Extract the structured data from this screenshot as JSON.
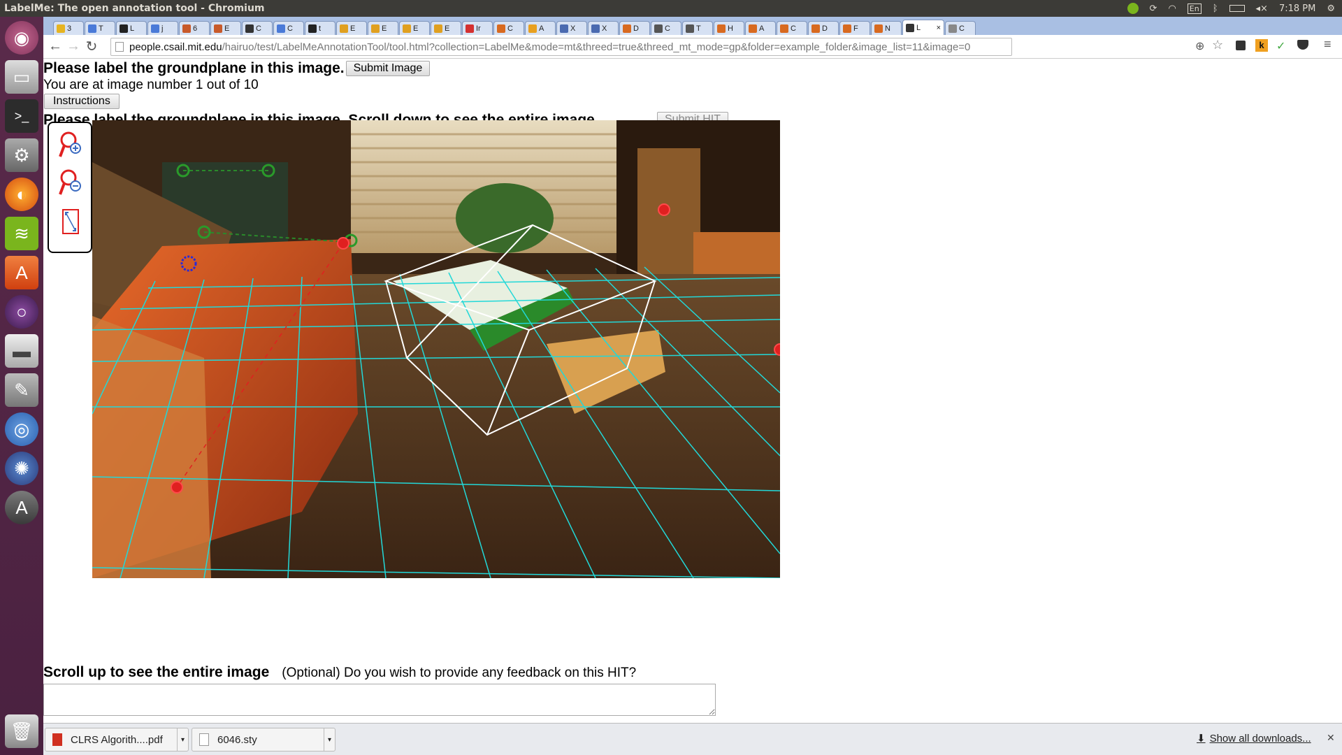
{
  "window_title": "LabelMe: The open annotation tool - Chromium",
  "system_tray": {
    "keyboard": "En",
    "time": "7:18 PM"
  },
  "tabs": [
    {
      "label": "3",
      "color": "#e6b422"
    },
    {
      "label": "T",
      "color": "#4a7ad8"
    },
    {
      "label": "L",
      "color": "#222222"
    },
    {
      "label": "j",
      "color": "#4a7ad8"
    },
    {
      "label": "6",
      "color": "#c85a2a"
    },
    {
      "label": "E",
      "color": "#c85a2a"
    },
    {
      "label": "C",
      "color": "#333333"
    },
    {
      "label": "C",
      "color": "#4a7ad8"
    },
    {
      "label": "t",
      "color": "#222222"
    },
    {
      "label": "E",
      "color": "#e0a020"
    },
    {
      "label": "E",
      "color": "#e0a020"
    },
    {
      "label": "E",
      "color": "#e0a020"
    },
    {
      "label": "E",
      "color": "#e0a020"
    },
    {
      "label": "Ir",
      "color": "#d43030"
    },
    {
      "label": "C",
      "color": "#d86a20"
    },
    {
      "label": "A",
      "color": "#e8a020"
    },
    {
      "label": "X",
      "color": "#4a6ab0"
    },
    {
      "label": "X",
      "color": "#4a6ab0"
    },
    {
      "label": "D",
      "color": "#d86a20"
    },
    {
      "label": "C",
      "color": "#555555"
    },
    {
      "label": "T",
      "color": "#555555"
    },
    {
      "label": "H",
      "color": "#d86a20"
    },
    {
      "label": "A",
      "color": "#d86a20"
    },
    {
      "label": "C",
      "color": "#d86a20"
    },
    {
      "label": "D",
      "color": "#d86a20"
    },
    {
      "label": "F",
      "color": "#d86a20"
    },
    {
      "label": "N",
      "color": "#d86a20"
    },
    {
      "label": "L",
      "color": "#333333",
      "active": true
    },
    {
      "label": "C",
      "color": "#888888"
    }
  ],
  "address_bar": {
    "host": "people.csail.mit.edu",
    "path": "/hairuo/test/LabelMeAnnotationTool/tool.html?collection=LabelMe&mode=mt&threed=true&threed_mt_mode=gp&folder=example_folder&image_list=11&image=0"
  },
  "page": {
    "heading": "Please label the groundplane in this image.",
    "submit_image": "Submit Image",
    "progress": "You are at image number 1 out of 10",
    "instructions": "Instructions",
    "heading2": "Please label the groundplane in this image. Scroll down to see the entire image.",
    "submit_hit": "Submit HIT",
    "scroll_up": "Scroll up to see the entire image",
    "feedback_prompt": "(Optional) Do you wish to provide any feedback on this HIT?"
  },
  "downloads": [
    {
      "name": "CLRS Algorith....pdf",
      "type": "pdf"
    },
    {
      "name": "6046.sty",
      "type": "file"
    }
  ],
  "show_all_downloads": "Show all downloads..."
}
